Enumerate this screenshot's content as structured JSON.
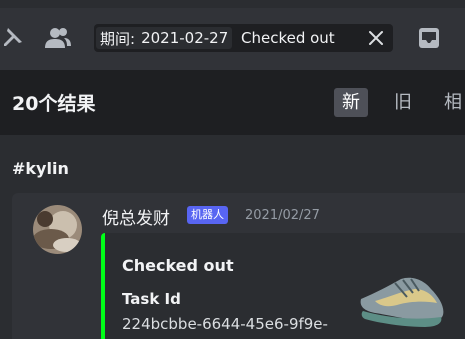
{
  "search": {
    "filter_key": "期间:",
    "filter_value": "2021-02-27",
    "query": "Checked out"
  },
  "results": {
    "count_label": "20个结果",
    "sort_tabs": [
      "新",
      "旧",
      "相"
    ],
    "active_sort": "新"
  },
  "channel": "#kylin",
  "message": {
    "author": "倪总发财",
    "bot_badge": "机器人",
    "timestamp": "2021/02/27",
    "embed": {
      "title": "Checked out",
      "field_name": "Task Id",
      "field_value": "224bcbbe-6644-45e6-9f9e-",
      "accent_color": "#00ff18"
    }
  },
  "icons": [
    "pin-icon",
    "members-icon",
    "clear-search-icon",
    "inbox-icon"
  ],
  "colors": {
    "background": "#2b2d31",
    "header": "#1e1f22",
    "bot_badge": "#5865f2",
    "active_tab": "#4e5058"
  }
}
